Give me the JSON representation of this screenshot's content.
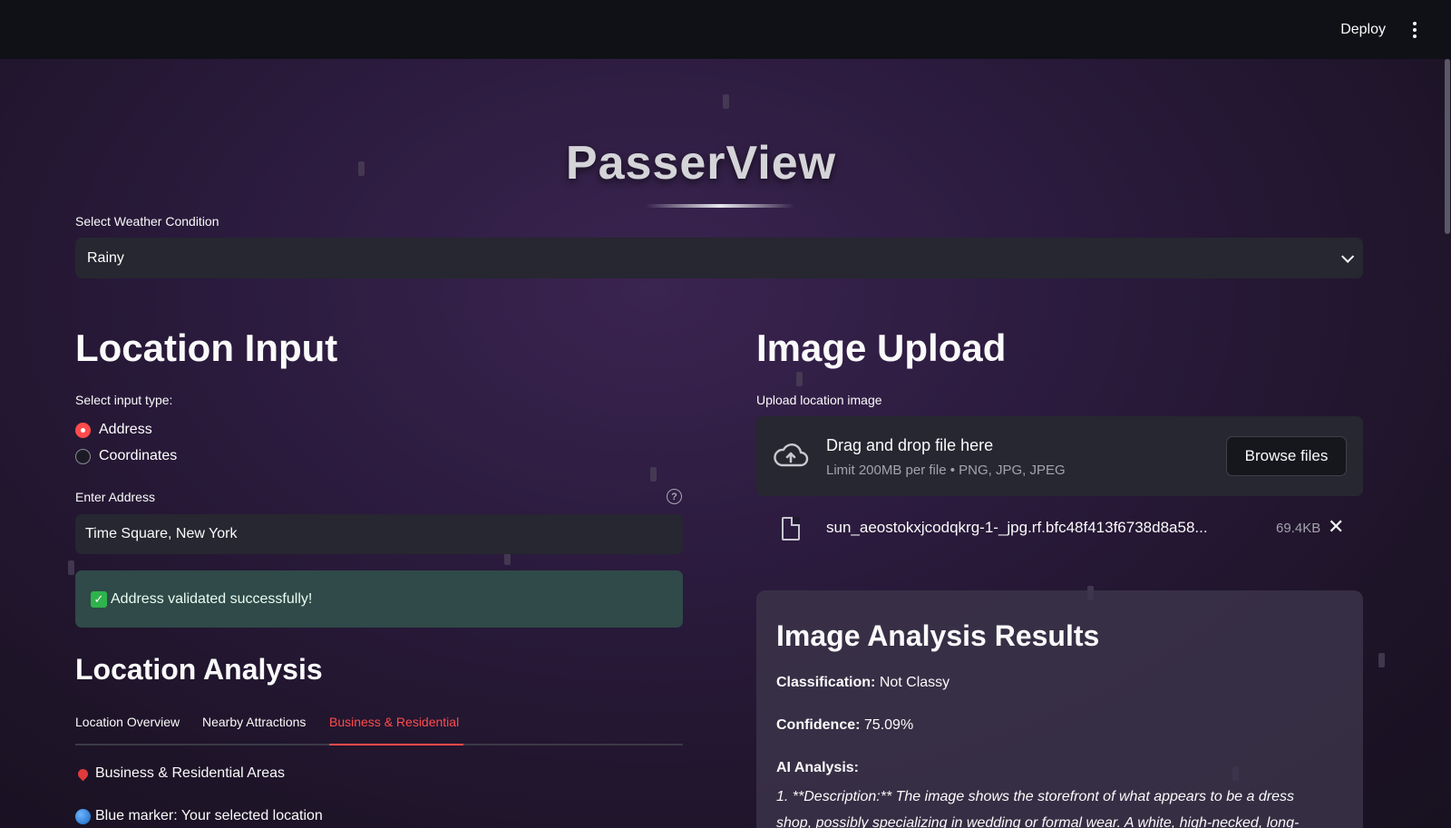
{
  "topbar": {
    "deploy_label": "Deploy",
    "menu_icon": "kebab-menu-icon"
  },
  "app": {
    "title": "PasserView"
  },
  "weather": {
    "label": "Select Weather Condition",
    "selected": "Rainy"
  },
  "location_input": {
    "heading": "Location Input",
    "input_type_label": "Select input type:",
    "options": [
      "Address",
      "Coordinates"
    ],
    "selected_option": "Address",
    "address_label": "Enter Address",
    "address_value": "Time Square, New York",
    "success_message": "Address validated successfully!"
  },
  "location_analysis": {
    "heading": "Location Analysis",
    "tabs": [
      "Location Overview",
      "Nearby Attractions",
      "Business & Residential"
    ],
    "active_tab": "Business & Residential",
    "areas_heading": "Business & Residential Areas",
    "blue_marker_text": "Blue marker: Your selected location"
  },
  "image_upload": {
    "heading": "Image Upload",
    "label": "Upload location image",
    "drop_title": "Drag and drop file here",
    "drop_subtitle": "Limit 200MB per file • PNG, JPG, JPEG",
    "browse_label": "Browse files",
    "file_name": "sun_aeostokxjcodqkrg-1-_jpg.rf.bfc48f413f6738d8a58...",
    "file_size": "69.4KB"
  },
  "analysis_results": {
    "heading": "Image Analysis Results",
    "classification_label": "Classification:",
    "classification_value": "Not Classy",
    "confidence_label": "Confidence:",
    "confidence_value": "75.09%",
    "ai_label": "AI Analysis:",
    "ai_text": "1. **Description:** The image shows the storefront of what appears to be a dress shop, possibly specializing in wedding or formal wear. A white, high-necked, long-"
  },
  "colors": {
    "accent": "#ff4b4b",
    "topbar": "#0f1117",
    "input_bg": "#262730",
    "success_bg": "#2f4a48"
  }
}
